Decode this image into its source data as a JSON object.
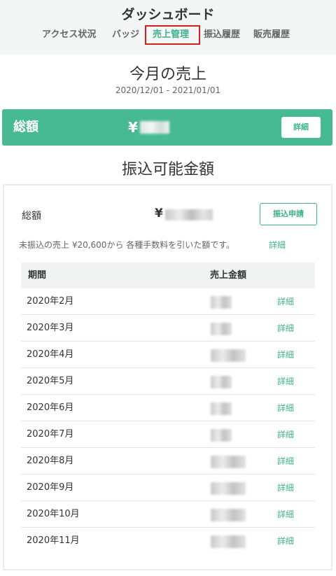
{
  "header": {
    "title": "ダッシュボード",
    "tabs": [
      {
        "label": "アクセス状況",
        "active": false
      },
      {
        "label": "バッジ",
        "active": false
      },
      {
        "label": "売上管理",
        "active": true
      },
      {
        "label": "振込履歴",
        "active": false
      },
      {
        "label": "販売履歴",
        "active": false
      }
    ]
  },
  "monthly": {
    "title": "今月の売上",
    "range": "2020/12/01 - 2021/01/01",
    "total_label": "総額",
    "currency": "¥",
    "detail_label": "詳細"
  },
  "payable": {
    "title": "振込可能金額",
    "total_label": "総額",
    "currency": "¥",
    "apply_label": "振込申請",
    "note": "未振込の売上 ¥20,600から 各種手数料を引いた額です。",
    "note_link": "詳細",
    "table": {
      "columns": [
        "期間",
        "売上金額"
      ],
      "rows": [
        {
          "period": "2020年2月",
          "link": "詳細"
        },
        {
          "period": "2020年3月",
          "link": "詳細"
        },
        {
          "period": "2020年4月",
          "link": "詳細"
        },
        {
          "period": "2020年5月",
          "link": "詳細"
        },
        {
          "period": "2020年6月",
          "link": "詳細"
        },
        {
          "period": "2020年7月",
          "link": "詳細"
        },
        {
          "period": "2020年8月",
          "link": "詳細"
        },
        {
          "period": "2020年9月",
          "link": "詳細"
        },
        {
          "period": "2020年10月",
          "link": "詳細"
        },
        {
          "period": "2020年11月",
          "link": "詳細"
        }
      ]
    }
  },
  "colors": {
    "accent": "#47b993",
    "link": "#3fb28a",
    "highlight_box": "#d0211c"
  }
}
